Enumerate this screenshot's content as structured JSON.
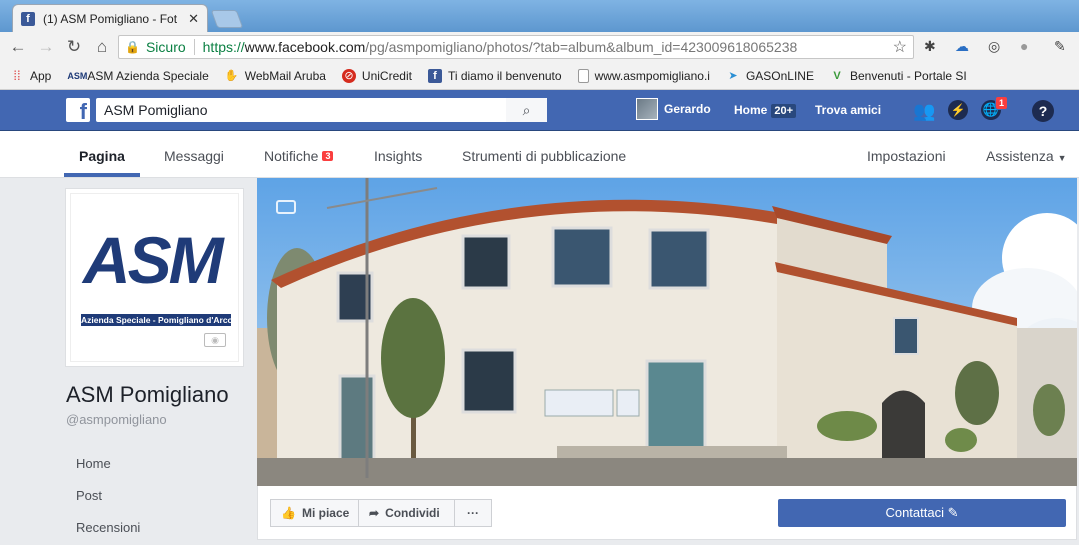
{
  "browser": {
    "tab_title": "(1) ASM Pomigliano - Fot",
    "secure_label": "Sicuro",
    "url_proto": "https://",
    "url_host": "www.facebook.com",
    "url_path": "/pg/asmpomigliano/photos/?tab=album&album_id=423009618065238",
    "bookmarks": [
      {
        "label": "App",
        "icon": "apps-grid-icon"
      },
      {
        "label": "ASM Azienda Speciale",
        "icon": "asm-icon"
      },
      {
        "label": "WebMail Aruba",
        "icon": "aruba-icon"
      },
      {
        "label": "UniCredit",
        "icon": "unicredit-icon"
      },
      {
        "label": "Ti diamo il benvenuto",
        "icon": "facebook-icon"
      },
      {
        "label": "www.asmpomigliano.i",
        "icon": "page-icon"
      },
      {
        "label": "GASOnLINE",
        "icon": "gas-icon"
      },
      {
        "label": "Benvenuti - Portale SI",
        "icon": "portal-icon"
      }
    ]
  },
  "fb": {
    "search_value": "ASM Pomigliano",
    "user_name": "Gerardo",
    "home_label": "Home",
    "home_count": "20+",
    "find_friends": "Trova amici",
    "notif_count": "1"
  },
  "page_tabs": {
    "pagina": "Pagina",
    "messaggi": "Messaggi",
    "notifiche": "Notifiche",
    "notifiche_count": "3",
    "insights": "Insights",
    "strumenti": "Strumenti di pubblicazione",
    "impostazioni": "Impostazioni",
    "assistenza": "Assistenza"
  },
  "page": {
    "logo_text": "ASM",
    "logo_sub": "Azienda Speciale - Pomigliano d'Arco",
    "name": "ASM Pomigliano",
    "handle": "@asmpomigliano",
    "nav": [
      "Home",
      "Post",
      "Recensioni"
    ]
  },
  "actions": {
    "like": "Mi piace",
    "share": "Condividi",
    "more": "···",
    "contact": "Contattaci"
  },
  "colors": {
    "fb_blue": "#4267b2",
    "badge_red": "#fa3e3e",
    "secure_green": "#0b8043"
  }
}
